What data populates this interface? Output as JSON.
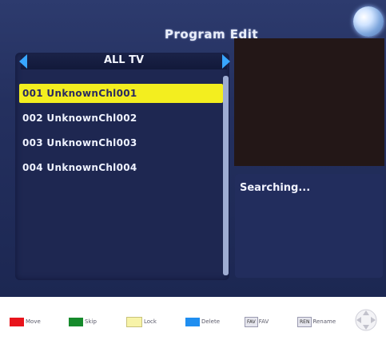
{
  "header": {
    "title": "Program Edit"
  },
  "list": {
    "group_label": "ALL TV",
    "channels": [
      "001 UnknownChl001",
      "002 UnknownChl002",
      "003 UnknownChl003",
      "004 UnknownChl004"
    ],
    "selected_index": 0
  },
  "info": {
    "status": "Searching..."
  },
  "legend": {
    "move": "Move",
    "skip": "Skip",
    "lock": "Lock",
    "delete": "Delete",
    "fav_key": "FAV",
    "fav": "FAV",
    "rename_key": "REN",
    "rename": "Rename"
  },
  "colors": {
    "accent_yellow": "#f3ee1f",
    "move_red": "#e8141c",
    "skip_green": "#168a2c",
    "lock_yellow": "#f7f3a8",
    "delete_blue": "#1f8ef0",
    "arrow_blue": "#38a6ff"
  },
  "icons": [
    "arrow-left-icon",
    "arrow-right-icon",
    "globe-icon",
    "dpad-icon"
  ]
}
